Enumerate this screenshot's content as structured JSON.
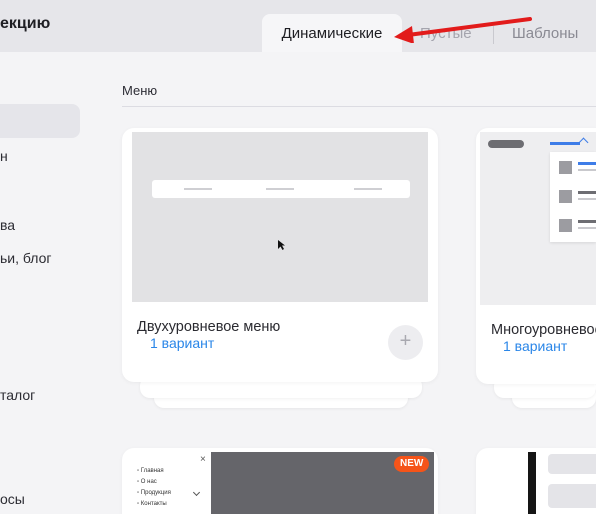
{
  "header": {
    "title": "екцию"
  },
  "tabs": [
    {
      "label": "Динамические",
      "active": true
    },
    {
      "label": "Пустые",
      "active": false
    },
    {
      "label": "Шаблоны",
      "active": false
    }
  ],
  "sidebar": {
    "items": [
      {
        "label": "н"
      },
      {
        "label": "ва"
      },
      {
        "label": "ьи, блог"
      },
      {
        "label": "талог"
      },
      {
        "label": "осы"
      }
    ]
  },
  "section": {
    "title": "Меню"
  },
  "cards": [
    {
      "name": "Двухуровневое меню",
      "variant": "1 вариант",
      "add_symbol": "+"
    },
    {
      "name": "Многоуровневое",
      "variant": "1 вариант"
    }
  ],
  "bottom_card": {
    "badge": "NEW",
    "close_symbol": "×",
    "menu_items": [
      "Главная",
      "О нас",
      "Продукция",
      "Контакты"
    ]
  },
  "colors": {
    "accent": "#2a86e8",
    "badge": "#f55419",
    "arrow": "#e21b1b"
  }
}
